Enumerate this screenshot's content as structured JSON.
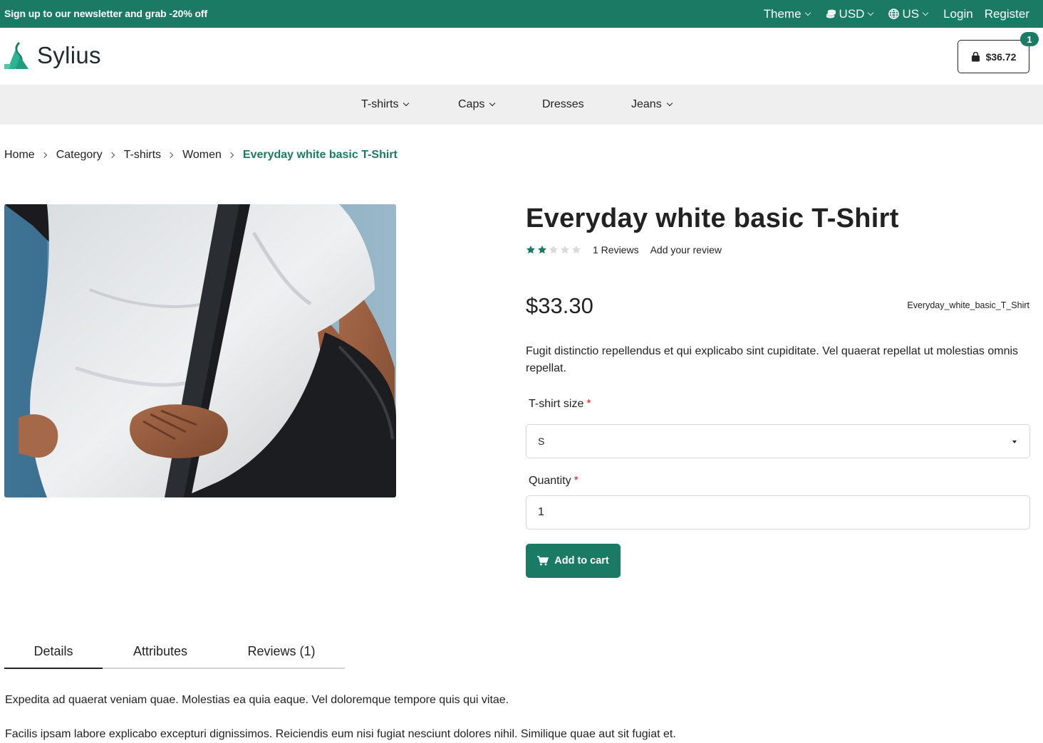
{
  "topbar": {
    "promo": "Sign up to our newsletter and grab -20% off",
    "theme": "Theme",
    "currency": "USD",
    "locale": "US",
    "login": "Login",
    "register": "Register"
  },
  "header": {
    "logo_text": "Sylius",
    "cart_total": "$36.72",
    "cart_count": "1"
  },
  "nav": {
    "items": [
      {
        "label": "T-shirts",
        "dropdown": true
      },
      {
        "label": "Caps",
        "dropdown": true
      },
      {
        "label": "Dresses",
        "dropdown": false
      },
      {
        "label": "Jeans",
        "dropdown": true
      }
    ]
  },
  "breadcrumb": {
    "items": [
      "Home",
      "Category",
      "T-shirts",
      "Women"
    ],
    "current": "Everyday white basic T-Shirt"
  },
  "product": {
    "title": "Everyday white basic T-Shirt",
    "rating": 2,
    "rating_max": 5,
    "reviews_label": "1 Reviews",
    "add_review": "Add your review",
    "price": "$33.30",
    "code": "Everyday_white_basic_T_Shirt",
    "description": "Fugit distinctio repellendus et qui explicabo sint cupiditate. Vel quaerat repellat ut molestias omnis repellat.",
    "size_label": "T-shirt size",
    "size_value": "S",
    "quantity_label": "Quantity",
    "quantity_value": "1",
    "required_mark": "*",
    "add_to_cart": "Add to cart"
  },
  "tabs": {
    "items": [
      "Details",
      "Attributes",
      "Reviews (1)"
    ],
    "active": "Details",
    "details_p1": "Expedita ad quaerat veniam quae. Molestias ea quia eaque. Vel doloremque tempore quis qui vitae.",
    "details_p2": "Facilis ipsam labore explicabo excepturi dignissimos. Reiciendis eum nisi fugiat nesciunt dolores nihil. Similique quae aut sit fugiat et."
  },
  "colors": {
    "brand": "#1a7a64",
    "nav_bg": "#efefef",
    "required": "#cc2222"
  }
}
